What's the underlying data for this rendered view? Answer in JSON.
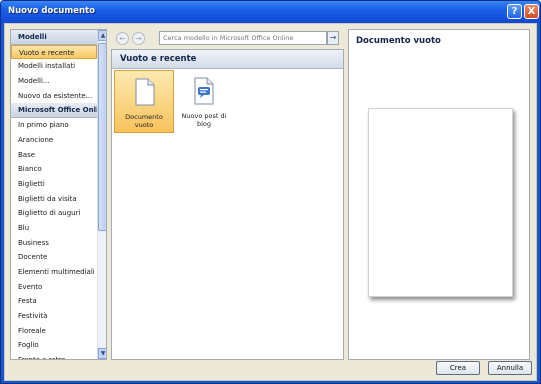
{
  "window": {
    "title": "Nuovo documento",
    "help_glyph": "?",
    "close_glyph": "X"
  },
  "sidebar": {
    "items": [
      {
        "label": "Modelli",
        "kind": "header"
      },
      {
        "label": "Vuoto e recente",
        "kind": "selected"
      },
      {
        "label": "Modelli installati",
        "kind": "item"
      },
      {
        "label": "Modelli...",
        "kind": "item"
      },
      {
        "label": "Nuovo da esistente...",
        "kind": "item"
      },
      {
        "label": "Microsoft Office Online",
        "kind": "header"
      },
      {
        "label": "In primo piano",
        "kind": "item"
      },
      {
        "label": "Arancione",
        "kind": "item"
      },
      {
        "label": "Base",
        "kind": "item"
      },
      {
        "label": "Bianco",
        "kind": "item"
      },
      {
        "label": "Biglietti",
        "kind": "item"
      },
      {
        "label": "Biglietti da visita",
        "kind": "item"
      },
      {
        "label": "Biglietto di auguri",
        "kind": "item"
      },
      {
        "label": "Blu",
        "kind": "item"
      },
      {
        "label": "Business",
        "kind": "item"
      },
      {
        "label": "Docente",
        "kind": "item"
      },
      {
        "label": "Elementi multimediali",
        "kind": "item"
      },
      {
        "label": "Evento",
        "kind": "item"
      },
      {
        "label": "Festa",
        "kind": "item"
      },
      {
        "label": "Festività",
        "kind": "item"
      },
      {
        "label": "Floreale",
        "kind": "item"
      },
      {
        "label": "Foglio",
        "kind": "item"
      },
      {
        "label": "Fronte e retro",
        "kind": "item"
      }
    ]
  },
  "toolbar": {
    "back_glyph": "←",
    "forward_glyph": "→",
    "search_placeholder": "Cerca modello in Microsoft Office Online",
    "search_go_glyph": "→"
  },
  "main": {
    "section_title": "Vuoto e recente",
    "tiles": [
      {
        "label": "Documento vuoto",
        "selected": true
      },
      {
        "label": "Nuovo post di blog",
        "selected": false
      }
    ]
  },
  "preview": {
    "title": "Documento vuoto"
  },
  "buttons": {
    "ok": "Crea",
    "cancel": "Annulla"
  },
  "colors": {
    "accent": "#1a5ee6",
    "selection": "#f8c865",
    "panel_bg": "#ece9d8"
  }
}
